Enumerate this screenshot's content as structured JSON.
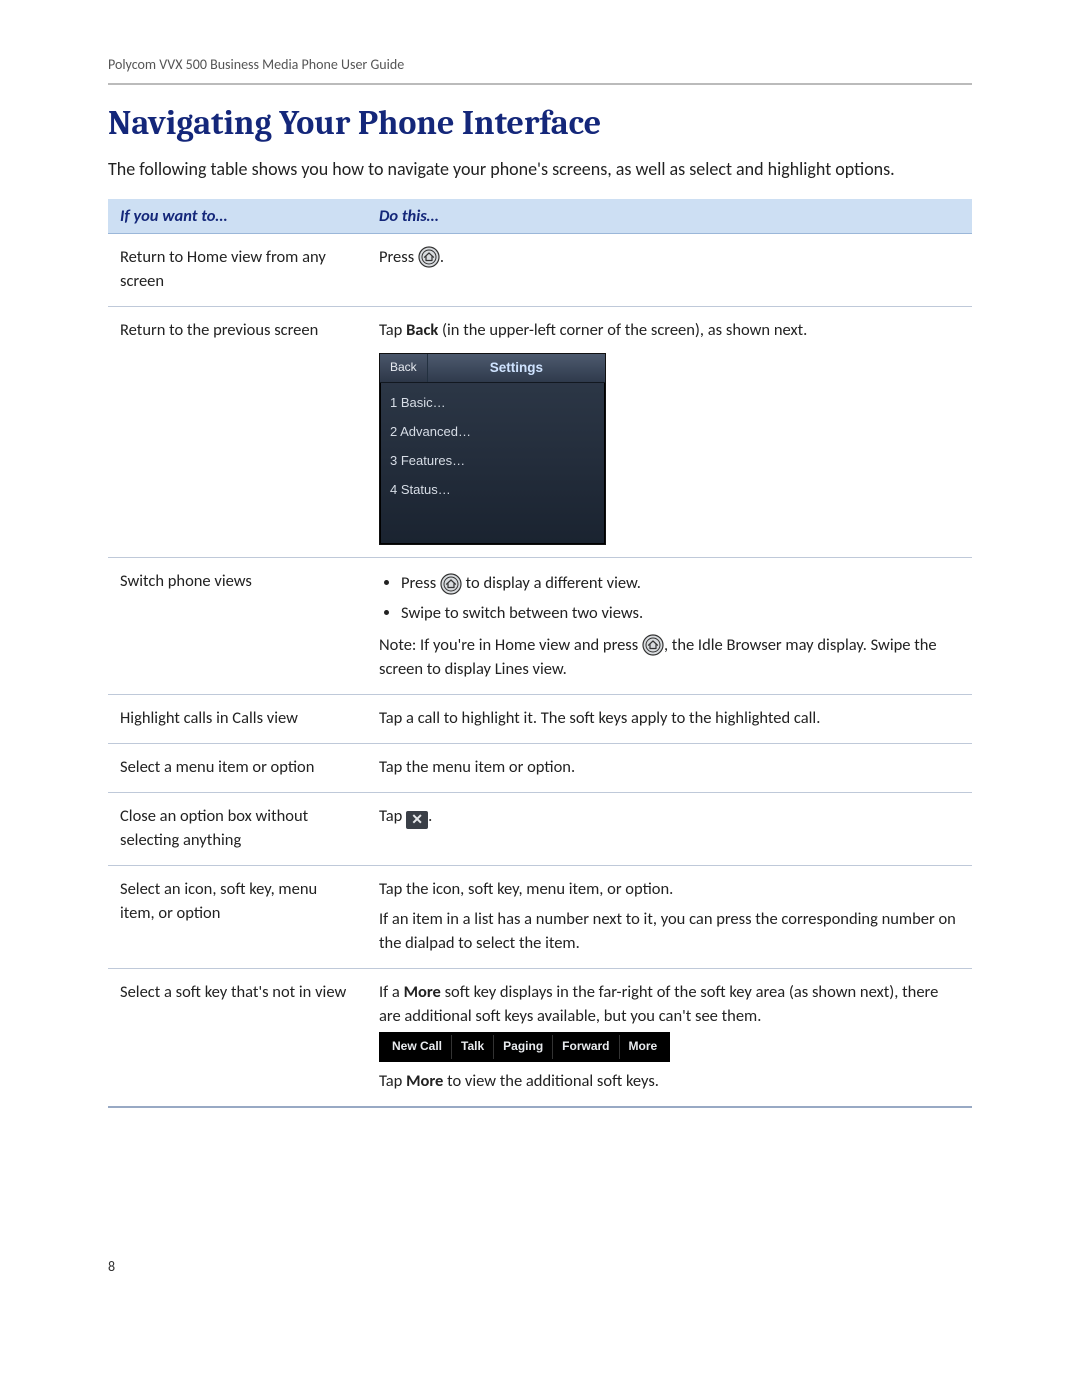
{
  "running_head": "Polycom VVX 500 Business Media Phone User Guide",
  "heading": "Navigating Your Phone Interface",
  "intro": "The following table shows you how to navigate your phone's screens, as well as select and highlight options.",
  "table_headers": {
    "col1": "If you want to…",
    "col2": "Do this…"
  },
  "rows": {
    "r1": {
      "want": "Return to Home view from any screen",
      "do_pre": "Press ",
      "do_post": "."
    },
    "r2": {
      "want": "Return to the previous screen",
      "do_pre": "Tap ",
      "do_bold": "Back",
      "do_post": " (in the upper-left corner of the screen), as shown next.",
      "shot": {
        "back": "Back",
        "title": "Settings",
        "items": [
          "1 Basic…",
          "2 Advanced…",
          "3 Features…",
          "4 Status…"
        ]
      }
    },
    "r3": {
      "want": "Switch phone views",
      "b1_pre": "Press ",
      "b1_post": " to display a different view.",
      "b2": "Swipe to switch between two views.",
      "note_pre": "Note: If you're in Home view and press ",
      "note_post": ", the Idle Browser may display. Swipe the screen to display Lines view."
    },
    "r4": {
      "want": "Highlight calls in Calls view",
      "do": "Tap a call to highlight it. The soft keys apply to the highlighted call."
    },
    "r5": {
      "want": "Select a menu item or option",
      "do": "Tap the menu item or option."
    },
    "r6": {
      "want": "Close an option box without selecting anything",
      "do_pre": "Tap ",
      "do_post": "."
    },
    "r7": {
      "want": "Select an icon, soft key, menu item, or option",
      "p1": "Tap the icon, soft key, menu item, or option.",
      "p2": "If an item in a list has a number next to it, you can press the corresponding number on the dialpad to select the item."
    },
    "r8": {
      "want": "Select a soft key that's not in view",
      "p1_a": "If a ",
      "p1_bold": "More",
      "p1_b": " soft key displays in the far-right of the soft key area (as shown next), there are additional soft keys available, but you can't see them.",
      "softkeys": [
        "New Call",
        "Talk",
        "Paging",
        "Forward",
        "More"
      ],
      "p2_a": "Tap ",
      "p2_bold": "More",
      "p2_b": " to view the additional soft keys."
    }
  },
  "page_number": "8"
}
